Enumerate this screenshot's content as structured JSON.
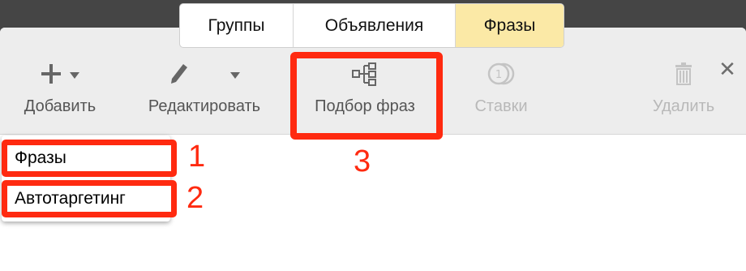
{
  "tabs": [
    {
      "label": "Группы"
    },
    {
      "label": "Объявления"
    },
    {
      "label": "Фразы"
    }
  ],
  "toolbar": {
    "add_label": "Добавить",
    "edit_label": "Редактировать",
    "phrase_pick_label": "Подбор фраз",
    "bids_label": "Ставки",
    "delete_label": "Удалить"
  },
  "dropdown": {
    "items": [
      "Фразы",
      "Автотаргетинг"
    ]
  },
  "annotations": {
    "n1": "1",
    "n2": "2",
    "n3": "3"
  },
  "colors": {
    "active_tab": "#fbe9a6",
    "highlight": "#ff2a10",
    "toolbar_bg": "#ededed"
  }
}
